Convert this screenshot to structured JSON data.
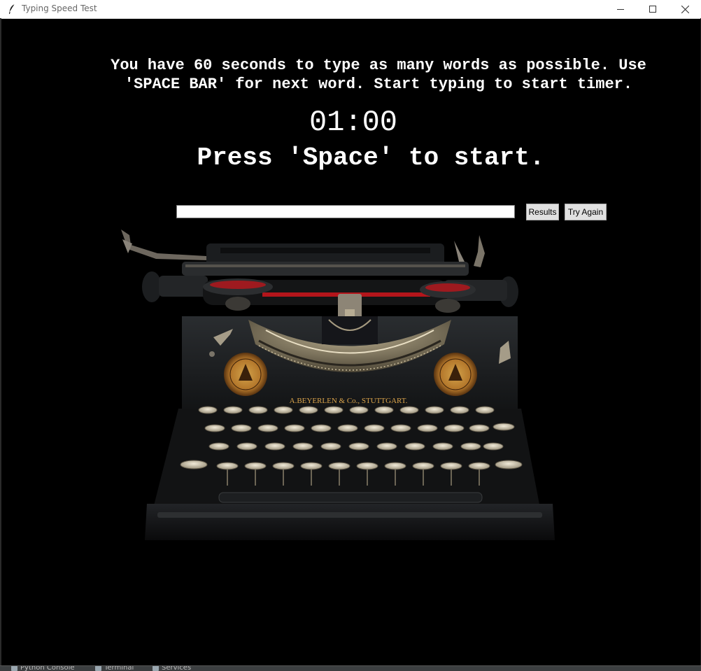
{
  "window": {
    "title": "Typing Speed Test",
    "icon": "feather-icon",
    "controls": [
      "minimize-icon",
      "maximize-icon",
      "close-icon"
    ]
  },
  "main": {
    "instructions": "You have 60 seconds to type as many words as possible. Use\n'SPACE BAR' for next word. Start typing to start timer.",
    "timer": "01:00",
    "prompt": "Press 'Space' to start.",
    "entry_value": "",
    "results_label": "Results",
    "try_again_label": "Try Again"
  },
  "typewriter": {
    "brand_plate": "A.BEYERLEN & Co., STUTTGART."
  },
  "ide_bar": {
    "tabs": [
      "Python Console",
      "Terminal",
      "Services"
    ]
  },
  "colors": {
    "background": "#000000",
    "text": "#ffffff",
    "titlebar": "#ffffff",
    "button": "#e1e1e1"
  }
}
